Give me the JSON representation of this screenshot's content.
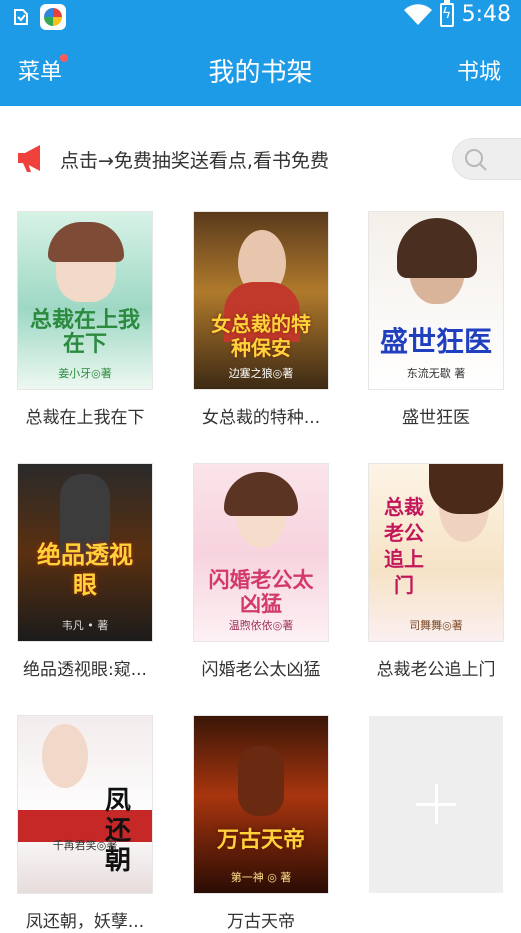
{
  "status_bar": {
    "time": "5:48",
    "icons": [
      "notification-icon",
      "app-icon",
      "wifi-icon",
      "battery-charging-icon"
    ]
  },
  "header": {
    "menu_label": "菜单",
    "title": "我的书架",
    "store_label": "书城",
    "accent": "#1e9be6"
  },
  "notice": {
    "text": "点击→免费抽奖送看点,看书免费"
  },
  "books": [
    {
      "title": "总裁在上我在下",
      "cover_title": "总裁在上我在下",
      "cover_author": "姜小牙◎著"
    },
    {
      "title": "女总裁的特种...",
      "cover_title": "女总裁的特种保安",
      "cover_author": "边塞之狼◎著"
    },
    {
      "title": "盛世狂医",
      "cover_title": "盛世狂医",
      "cover_author": "东流无歇 著"
    },
    {
      "title": "绝品透视眼:窥...",
      "cover_title": "绝品透视眼",
      "cover_author": "韦凡 • 著"
    },
    {
      "title": "闪婚老公太凶猛",
      "cover_title": "闪婚老公太凶猛",
      "cover_author": "温煦依依◎著"
    },
    {
      "title": "总裁老公追上门",
      "cover_title": "总裁老公追上门",
      "cover_author": "司舞舞◎著"
    },
    {
      "title": "凤还朝，妖孽...",
      "cover_title": "凤还朝",
      "cover_author": "千苒君笑◎著"
    },
    {
      "title": "万古天帝",
      "cover_title": "万古天帝",
      "cover_author": "第一神 ◎ 著"
    }
  ]
}
